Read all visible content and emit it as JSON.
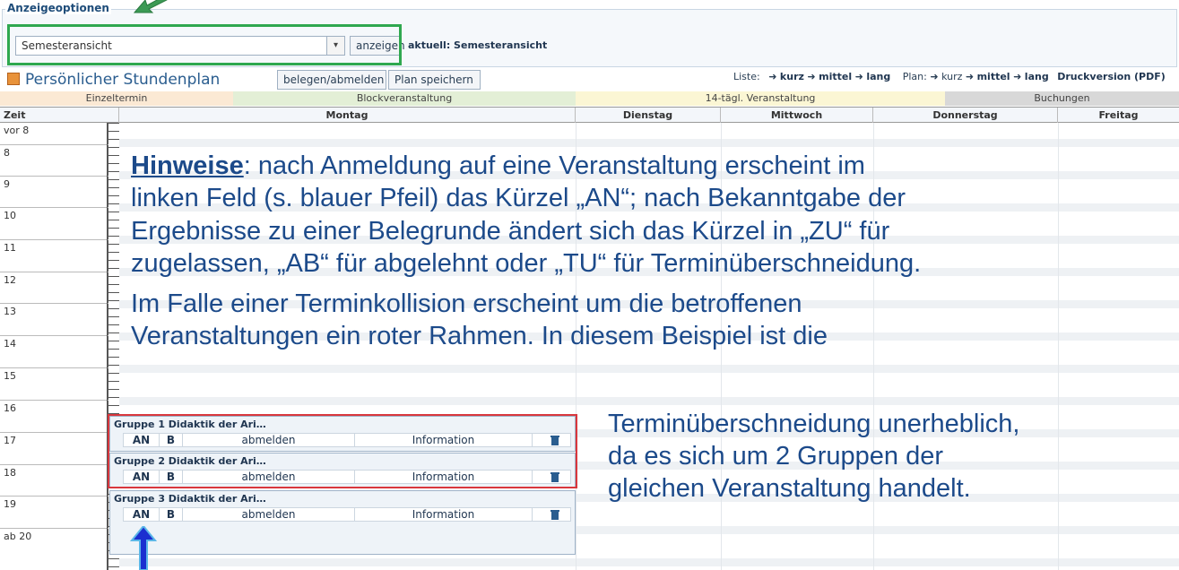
{
  "options": {
    "legend": "Anzeigeoptionen",
    "select_value": "Semesteransicht",
    "show_button": "anzeigen",
    "current": "aktuell: Semesteransicht"
  },
  "header": {
    "title": "Persönlicher Stundenplan",
    "enroll_button": "belegen/abmelden",
    "save_button": "Plan speichern",
    "list_label": "Liste:",
    "plan_label": "Plan:",
    "short": "kurz",
    "medium": "mittel",
    "long": "lang",
    "print": "Druckversion (PDF)"
  },
  "legend_bar": {
    "single": "Einzeltermin",
    "block": "Blockveranstaltung",
    "biweekly": "14-tägl. Veranstaltung",
    "bookings": "Buchungen"
  },
  "columns": [
    "Zeit",
    "Montag",
    "Dienstag",
    "Mittwoch",
    "Donnerstag",
    "Freitag"
  ],
  "time_slots": [
    "vor 8",
    "8",
    "9",
    "10",
    "11",
    "12",
    "13",
    "14",
    "15",
    "16",
    "17",
    "18",
    "19",
    "ab 20"
  ],
  "events": [
    {
      "title": "Gruppe 1 Didaktik der Ari…",
      "status": "AN",
      "type": "B",
      "action": "abmelden",
      "info": "Information"
    },
    {
      "title": "Gruppe 2 Didaktik der Ari…",
      "status": "AN",
      "type": "B",
      "action": "abmelden",
      "info": "Information"
    },
    {
      "title": "Gruppe 3 Didaktik der Ari…",
      "status": "AN",
      "type": "B",
      "action": "abmelden",
      "info": "Information"
    }
  ],
  "notes": {
    "hinweise": "Hinweise",
    "line1": ": nach Anmeldung auf eine Veranstaltung erscheint im",
    "line2": "linken Feld (s. blauer Pfeil) das Kürzel „AN“; nach Bekanntgabe der",
    "line3": "Ergebnisse zu einer Belegrunde ändert sich das Kürzel in „ZU“ für",
    "line4": "zugelassen, „AB“ für abgelehnt oder „TU“ für Terminüberschneidung.",
    "line5": "Im Falle einer Terminkollision erscheint um die betroffenen",
    "line6": "Veranstaltungen ein roter Rahmen. In diesem Beispiel ist die",
    "line7": "Terminüberschneidung unerheblich,",
    "line8": "da es sich um 2 Gruppen der",
    "line9": "gleichen Veranstaltung handelt."
  },
  "colors": {
    "green_frame": "#2fa84f",
    "red_frame": "#d9373d",
    "arrow_blue": "#1b2fd0",
    "text_blue": "#1c4a8a"
  },
  "icons": [
    "calendar-icon",
    "trash-icon",
    "arrow-right-icon"
  ]
}
